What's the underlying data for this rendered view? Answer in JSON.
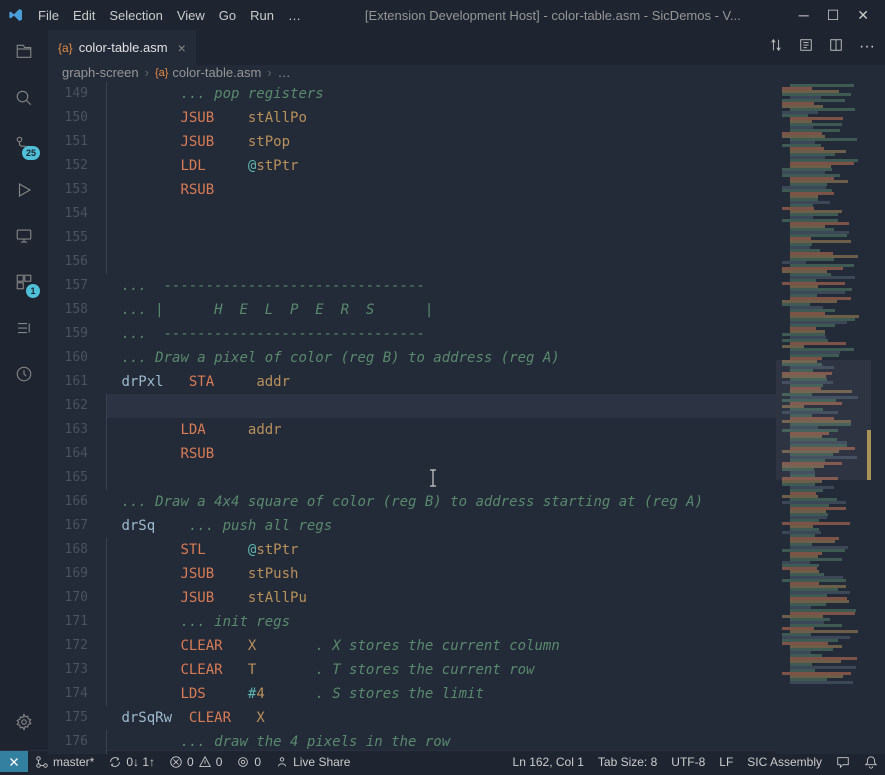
{
  "window": {
    "title": "[Extension Development Host] - color-table.asm - SicDemos - V..."
  },
  "menu": {
    "items": [
      "File",
      "Edit",
      "Selection",
      "View",
      "Go",
      "Run",
      "…"
    ]
  },
  "tab": {
    "filename": "color-table.asm"
  },
  "breadcrumbs": {
    "items": [
      "graph-screen",
      "color-table.asm",
      "…"
    ]
  },
  "activity": {
    "scm_badge": "25",
    "ext_badge": "1"
  },
  "gutter_start": 149,
  "code": [
    {
      "n": 149,
      "indent": 1,
      "parts": [
        [
          "comment",
          "... pop registers"
        ]
      ]
    },
    {
      "n": 150,
      "indent": 1,
      "parts": [
        [
          "mnemonic",
          "JSUB"
        ],
        [
          "ws",
          "    "
        ],
        [
          "operand",
          "stAllPo"
        ]
      ]
    },
    {
      "n": 151,
      "indent": 1,
      "parts": [
        [
          "mnemonic",
          "JSUB"
        ],
        [
          "ws",
          "    "
        ],
        [
          "operand",
          "stPop"
        ]
      ]
    },
    {
      "n": 152,
      "indent": 1,
      "parts": [
        [
          "mnemonic",
          "LDL"
        ],
        [
          "ws",
          "     "
        ],
        [
          "sigil",
          "@"
        ],
        [
          "operand",
          "stPtr"
        ]
      ]
    },
    {
      "n": 153,
      "indent": 1,
      "parts": [
        [
          "mnemonic",
          "RSUB"
        ]
      ]
    },
    {
      "n": 154,
      "indent": 1,
      "parts": []
    },
    {
      "n": 155,
      "indent": 1,
      "parts": []
    },
    {
      "n": 156,
      "indent": 1,
      "parts": []
    },
    {
      "n": 157,
      "no_guide": true,
      "parts": [
        [
          "comment",
          "...  -------------------------------"
        ]
      ]
    },
    {
      "n": 158,
      "no_guide": true,
      "parts": [
        [
          "comment",
          "... |      H  E  L  P  E  R  S      |"
        ]
      ]
    },
    {
      "n": 159,
      "no_guide": true,
      "parts": [
        [
          "comment",
          "...  -------------------------------"
        ]
      ]
    },
    {
      "n": 160,
      "no_guide": true,
      "parts": [
        [
          "comment",
          "... Draw a pixel of color (reg B) to address (reg A)"
        ]
      ]
    },
    {
      "n": 161,
      "no_guide": true,
      "parts": [
        [
          "label",
          "drPxl   "
        ],
        [
          "mnemonic",
          "STA"
        ],
        [
          "ws",
          "     "
        ],
        [
          "operand",
          "addr"
        ]
      ]
    },
    {
      "n": 162,
      "cursor": true,
      "indent": 1,
      "parts": []
    },
    {
      "n": 163,
      "indent": 1,
      "parts": [
        [
          "mnemonic",
          "LDA"
        ],
        [
          "ws",
          "     "
        ],
        [
          "operand",
          "addr"
        ]
      ]
    },
    {
      "n": 164,
      "indent": 1,
      "parts": [
        [
          "mnemonic",
          "RSUB"
        ]
      ]
    },
    {
      "n": 165,
      "indent": 1,
      "parts": []
    },
    {
      "n": 166,
      "no_guide": true,
      "parts": [
        [
          "comment",
          "... Draw a 4x4 square of color (reg B) to address starting at (reg A)"
        ]
      ]
    },
    {
      "n": 167,
      "no_guide": true,
      "parts": [
        [
          "label",
          "drSq    "
        ],
        [
          "comment",
          "... push all regs"
        ]
      ]
    },
    {
      "n": 168,
      "indent": 1,
      "parts": [
        [
          "mnemonic",
          "STL"
        ],
        [
          "ws",
          "     "
        ],
        [
          "sigil",
          "@"
        ],
        [
          "operand",
          "stPtr"
        ]
      ]
    },
    {
      "n": 169,
      "indent": 1,
      "parts": [
        [
          "mnemonic",
          "JSUB"
        ],
        [
          "ws",
          "    "
        ],
        [
          "operand",
          "stPush"
        ]
      ]
    },
    {
      "n": 170,
      "indent": 1,
      "parts": [
        [
          "mnemonic",
          "JSUB"
        ],
        [
          "ws",
          "    "
        ],
        [
          "operand",
          "stAllPu"
        ]
      ]
    },
    {
      "n": 171,
      "indent": 1,
      "parts": [
        [
          "comment",
          "... init regs"
        ]
      ]
    },
    {
      "n": 172,
      "indent": 1,
      "parts": [
        [
          "mnemonic",
          "CLEAR"
        ],
        [
          "ws",
          "   "
        ],
        [
          "operand",
          "X"
        ],
        [
          "ws",
          "       "
        ],
        [
          "comment",
          ". X stores the current column"
        ]
      ]
    },
    {
      "n": 173,
      "indent": 1,
      "parts": [
        [
          "mnemonic",
          "CLEAR"
        ],
        [
          "ws",
          "   "
        ],
        [
          "operand",
          "T"
        ],
        [
          "ws",
          "       "
        ],
        [
          "comment",
          ". T stores the current row"
        ]
      ]
    },
    {
      "n": 174,
      "indent": 1,
      "parts": [
        [
          "mnemonic",
          "LDS"
        ],
        [
          "ws",
          "     "
        ],
        [
          "sigil",
          "#"
        ],
        [
          "operand",
          "4"
        ],
        [
          "ws",
          "      "
        ],
        [
          "comment",
          ". S stores the limit"
        ]
      ]
    },
    {
      "n": 175,
      "no_guide": true,
      "parts": [
        [
          "label",
          "drSqRw  "
        ],
        [
          "mnemonic",
          "CLEAR"
        ],
        [
          "ws",
          "   "
        ],
        [
          "operand",
          "X"
        ]
      ]
    },
    {
      "n": 176,
      "indent": 1,
      "parts": [
        [
          "comment",
          "... draw the 4 pixels in the row"
        ]
      ]
    }
  ],
  "status": {
    "branch": "master*",
    "sync": "0↓ 1↑",
    "problems": "0",
    "warnings": "0",
    "port": "0",
    "liveshare": "Live Share",
    "cursor": "Ln 162, Col 1",
    "tabsize": "Tab Size: 8",
    "encoding": "UTF-8",
    "eol": "LF",
    "lang": "SIC Assembly"
  }
}
